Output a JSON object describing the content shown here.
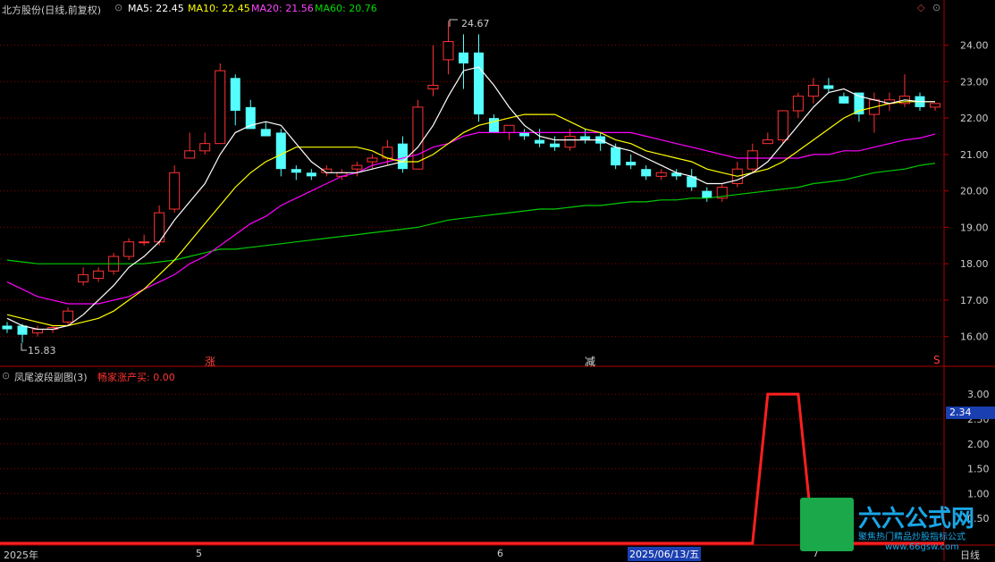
{
  "header": {
    "title": "北方股份(日线,前复权)",
    "ma5": "MA5: 22.45",
    "ma10": "MA10: 22.45",
    "ma20": "MA20: 21.56",
    "ma60": "MA60: 20.76",
    "ma5_color": "#ffffff",
    "ma10_color": "#ffff00",
    "ma20_color": "#ff00ff",
    "ma60_color": "#00cc00"
  },
  "sub_header": {
    "title": "凤尾波段副图(3)",
    "indicator": "畅家涨产买: 0.00",
    "indicator_color": "#ff3333"
  },
  "annotations": {
    "high": "24.67",
    "low": "15.83",
    "rise_marker": "涨",
    "fall_marker": "减",
    "s_marker": "S"
  },
  "x_axis": {
    "labels": [
      "2025年",
      "5",
      "6",
      "2025/06/13/五",
      "7"
    ],
    "period": "日线"
  },
  "sub_current": "2.34",
  "logo": {
    "name": "六六公式网",
    "sub": "聚焦热门精品炒股指标公式",
    "url": "www.66gsw.com"
  },
  "watermark_text": "六六公式网",
  "chart_data": {
    "type": "candlestick",
    "y_axis_main": [
      "24.00",
      "23.00",
      "22.00",
      "21.00",
      "20.00",
      "19.00",
      "18.00",
      "17.00",
      "16.00"
    ],
    "y_axis_sub": [
      "3.00",
      "2.50",
      "2.00",
      "1.50",
      "1.00",
      "0.50"
    ],
    "ylim_main": [
      15.6,
      24.8
    ],
    "ylim_sub": [
      0,
      3.2
    ],
    "candles": [
      [
        16.3,
        16.4,
        16.1,
        16.2
      ],
      [
        16.3,
        16.35,
        15.83,
        16.05
      ],
      [
        16.1,
        16.3,
        16.0,
        16.2
      ],
      [
        16.2,
        16.3,
        16.1,
        16.25
      ],
      [
        16.4,
        16.8,
        16.3,
        16.7
      ],
      [
        17.5,
        17.9,
        17.4,
        17.7
      ],
      [
        17.6,
        17.9,
        17.5,
        17.8
      ],
      [
        17.8,
        18.3,
        17.7,
        18.2
      ],
      [
        18.2,
        18.7,
        18.1,
        18.6
      ],
      [
        18.6,
        18.8,
        18.5,
        18.6
      ],
      [
        18.6,
        19.6,
        18.5,
        19.4
      ],
      [
        19.5,
        20.7,
        19.4,
        20.5
      ],
      [
        20.9,
        21.6,
        20.9,
        21.1
      ],
      [
        21.1,
        21.6,
        21.0,
        21.3
      ],
      [
        21.3,
        23.5,
        21.3,
        23.3
      ],
      [
        23.1,
        23.2,
        21.8,
        22.2
      ],
      [
        22.3,
        22.5,
        21.8,
        21.7
      ],
      [
        21.7,
        21.9,
        21.5,
        21.5
      ],
      [
        21.6,
        21.7,
        20.4,
        20.6
      ],
      [
        20.6,
        20.7,
        20.3,
        20.5
      ],
      [
        20.5,
        20.6,
        20.3,
        20.4
      ],
      [
        20.5,
        20.7,
        20.4,
        20.6
      ],
      [
        20.4,
        20.6,
        20.3,
        20.5
      ],
      [
        20.6,
        20.8,
        20.4,
        20.7
      ],
      [
        20.8,
        21.0,
        20.6,
        20.9
      ],
      [
        20.9,
        21.4,
        20.7,
        21.2
      ],
      [
        21.3,
        21.5,
        20.5,
        20.6
      ],
      [
        20.6,
        22.5,
        20.6,
        22.3
      ],
      [
        22.8,
        24.0,
        22.6,
        22.9
      ],
      [
        23.6,
        24.67,
        23.2,
        24.1
      ],
      [
        23.8,
        24.3,
        22.8,
        23.5
      ],
      [
        23.8,
        24.3,
        21.9,
        22.1
      ],
      [
        22.0,
        22.1,
        21.6,
        21.6
      ],
      [
        21.6,
        21.8,
        21.4,
        21.8
      ],
      [
        21.6,
        21.7,
        21.4,
        21.5
      ],
      [
        21.4,
        21.7,
        21.2,
        21.3
      ],
      [
        21.3,
        21.5,
        21.1,
        21.2
      ],
      [
        21.2,
        21.7,
        21.1,
        21.5
      ],
      [
        21.5,
        21.7,
        21.3,
        21.4
      ],
      [
        21.5,
        21.6,
        21.1,
        21.3
      ],
      [
        21.2,
        21.3,
        20.6,
        20.7
      ],
      [
        20.8,
        21.0,
        20.6,
        20.7
      ],
      [
        20.6,
        20.7,
        20.3,
        20.4
      ],
      [
        20.4,
        20.6,
        20.3,
        20.5
      ],
      [
        20.5,
        20.6,
        20.3,
        20.4
      ],
      [
        20.4,
        20.6,
        20.0,
        20.1
      ],
      [
        20.0,
        20.1,
        19.7,
        19.8
      ],
      [
        19.8,
        20.2,
        19.7,
        20.1
      ],
      [
        20.2,
        20.8,
        20.1,
        20.6
      ],
      [
        20.6,
        21.3,
        20.5,
        21.1
      ],
      [
        21.3,
        21.6,
        21.3,
        21.4
      ],
      [
        21.4,
        22.2,
        21.3,
        22.2
      ],
      [
        22.2,
        22.7,
        22.0,
        22.6
      ],
      [
        22.6,
        23.1,
        22.4,
        22.9
      ],
      [
        22.9,
        23.1,
        22.7,
        22.8
      ],
      [
        22.6,
        22.7,
        22.4,
        22.4
      ],
      [
        22.7,
        22.7,
        21.9,
        22.1
      ],
      [
        22.1,
        22.7,
        21.6,
        22.5
      ],
      [
        22.4,
        22.7,
        22.2,
        22.5
      ],
      [
        22.4,
        23.2,
        22.3,
        22.6
      ],
      [
        22.6,
        22.7,
        22.2,
        22.3
      ],
      [
        22.3,
        22.4,
        22.2,
        22.4
      ]
    ],
    "ma5": [
      16.5,
      16.3,
      16.2,
      16.2,
      16.3,
      16.6,
      17.0,
      17.4,
      17.9,
      18.2,
      18.6,
      19.2,
      19.7,
      20.2,
      21.0,
      21.6,
      21.8,
      21.9,
      21.8,
      21.3,
      20.8,
      20.5,
      20.5,
      20.5,
      20.6,
      20.7,
      20.8,
      21.2,
      21.8,
      22.6,
      23.3,
      23.4,
      22.9,
      22.3,
      21.8,
      21.5,
      21.4,
      21.4,
      21.4,
      21.4,
      21.2,
      21.1,
      20.9,
      20.7,
      20.5,
      20.4,
      20.2,
      20.2,
      20.3,
      20.5,
      20.8,
      21.3,
      21.8,
      22.3,
      22.7,
      22.8,
      22.6,
      22.5,
      22.4,
      22.5,
      22.45,
      22.45
    ],
    "ma10": [
      16.6,
      16.5,
      16.4,
      16.3,
      16.3,
      16.4,
      16.5,
      16.7,
      17.0,
      17.3,
      17.7,
      18.1,
      18.6,
      19.1,
      19.6,
      20.1,
      20.5,
      20.8,
      21.0,
      21.2,
      21.2,
      21.2,
      21.2,
      21.2,
      21.1,
      20.9,
      20.8,
      20.8,
      21.0,
      21.3,
      21.6,
      21.8,
      21.9,
      22.0,
      22.1,
      22.1,
      22.1,
      21.9,
      21.7,
      21.6,
      21.4,
      21.3,
      21.1,
      21.0,
      20.9,
      20.8,
      20.6,
      20.5,
      20.4,
      20.5,
      20.6,
      20.8,
      21.1,
      21.4,
      21.7,
      22.0,
      22.2,
      22.3,
      22.4,
      22.45,
      22.45,
      22.45
    ],
    "ma20": [
      17.5,
      17.3,
      17.1,
      17.0,
      16.9,
      16.9,
      16.9,
      17.0,
      17.1,
      17.3,
      17.5,
      17.7,
      18.0,
      18.2,
      18.5,
      18.8,
      19.1,
      19.3,
      19.6,
      19.8,
      20.0,
      20.2,
      20.4,
      20.5,
      20.7,
      20.8,
      20.9,
      21.0,
      21.2,
      21.3,
      21.5,
      21.6,
      21.6,
      21.6,
      21.6,
      21.6,
      21.6,
      21.6,
      21.6,
      21.6,
      21.6,
      21.6,
      21.5,
      21.4,
      21.3,
      21.2,
      21.1,
      21.0,
      20.9,
      20.9,
      20.9,
      20.9,
      20.9,
      21.0,
      21.0,
      21.1,
      21.1,
      21.2,
      21.3,
      21.4,
      21.45,
      21.56
    ],
    "ma60": [
      18.1,
      18.05,
      18.0,
      18.0,
      18.0,
      18.0,
      18.0,
      18.0,
      18.0,
      18.0,
      18.05,
      18.1,
      18.2,
      18.3,
      18.4,
      18.4,
      18.45,
      18.5,
      18.55,
      18.6,
      18.65,
      18.7,
      18.75,
      18.8,
      18.85,
      18.9,
      18.95,
      19.0,
      19.1,
      19.2,
      19.25,
      19.3,
      19.35,
      19.4,
      19.45,
      19.5,
      19.5,
      19.55,
      19.6,
      19.6,
      19.65,
      19.7,
      19.7,
      19.75,
      19.75,
      19.8,
      19.8,
      19.85,
      19.9,
      19.95,
      20.0,
      20.05,
      20.1,
      20.2,
      20.25,
      20.3,
      20.4,
      20.5,
      20.55,
      20.6,
      20.7,
      20.76
    ],
    "sub_line": [
      0,
      0,
      0,
      0,
      0,
      0,
      0,
      0,
      0,
      0,
      0,
      0,
      0,
      0,
      0,
      0,
      0,
      0,
      0,
      0,
      0,
      0,
      0,
      0,
      0,
      0,
      0,
      0,
      0,
      0,
      0,
      0,
      0,
      0,
      0,
      0,
      0,
      0,
      0,
      0,
      0,
      0,
      0,
      0,
      0,
      0,
      0,
      0,
      0,
      0,
      3,
      3,
      3,
      0,
      0,
      0,
      0,
      0,
      0,
      0,
      0,
      0
    ]
  }
}
